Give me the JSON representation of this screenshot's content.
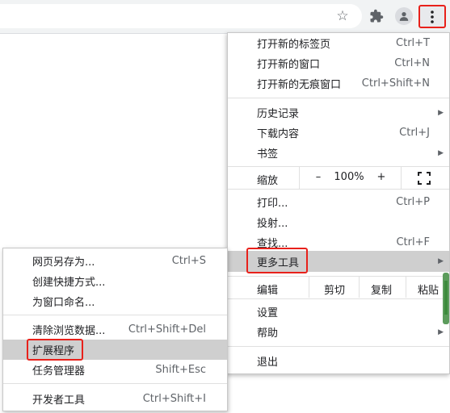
{
  "toolbar": {
    "icons": [
      "star-icon",
      "puzzle-icon",
      "profile-icon",
      "more-vert-icon"
    ]
  },
  "menu": {
    "new_tab": {
      "label": "打开新的标签页",
      "shortcut": "Ctrl+T"
    },
    "new_window": {
      "label": "打开新的窗口",
      "shortcut": "Ctrl+N"
    },
    "new_incognito": {
      "label": "打开新的无痕窗口",
      "shortcut": "Ctrl+Shift+N"
    },
    "history": {
      "label": "历史记录"
    },
    "downloads": {
      "label": "下载内容",
      "shortcut": "Ctrl+J"
    },
    "bookmarks": {
      "label": "书签"
    },
    "zoom": {
      "label": "缩放",
      "minus": "–",
      "value": "100%",
      "plus": "+"
    },
    "print": {
      "label": "打印...",
      "shortcut": "Ctrl+P"
    },
    "cast": {
      "label": "投射..."
    },
    "find": {
      "label": "查找...",
      "shortcut": "Ctrl+F"
    },
    "more_tools": {
      "label": "更多工具"
    },
    "edit": {
      "label": "编辑",
      "cut": "剪切",
      "copy": "复制",
      "paste": "粘贴"
    },
    "settings": {
      "label": "设置"
    },
    "help": {
      "label": "帮助"
    },
    "exit": {
      "label": "退出"
    }
  },
  "submenu": {
    "save_page": {
      "label": "网页另存为...",
      "shortcut": "Ctrl+S"
    },
    "create_shortcut": {
      "label": "创建快捷方式..."
    },
    "name_window": {
      "label": "为窗口命名..."
    },
    "clear_data": {
      "label": "清除浏览数据...",
      "shortcut": "Ctrl+Shift+Del"
    },
    "extensions": {
      "label": "扩展程序"
    },
    "task_manager": {
      "label": "任务管理器",
      "shortcut": "Shift+Esc"
    },
    "dev_tools": {
      "label": "开发者工具",
      "shortcut": "Ctrl+Shift+I"
    }
  },
  "colors": {
    "highlight_border": "#e8211b",
    "hover_bg": "#cfcfcf",
    "toolbar_bg": "#f1f3f4",
    "scrollbar": "#5c9c5c"
  }
}
